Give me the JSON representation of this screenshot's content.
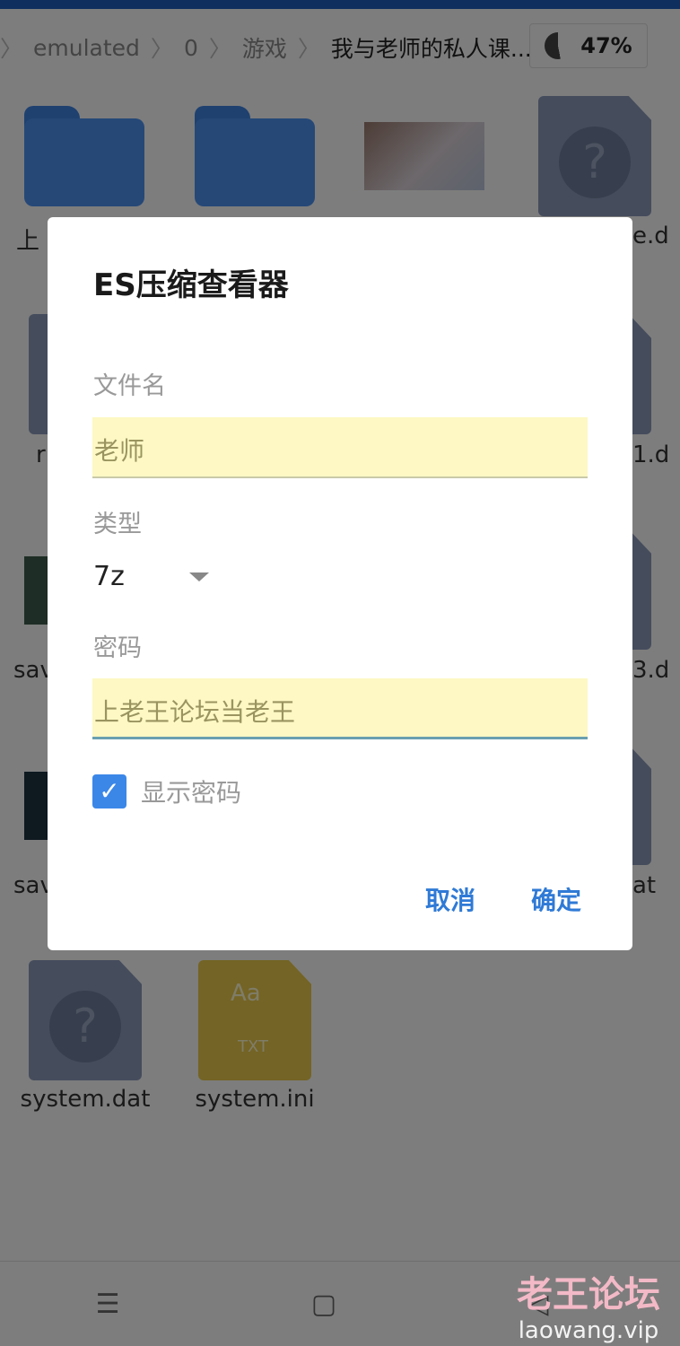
{
  "breadcrumb": {
    "items": [
      "emulated",
      "0",
      "游戏",
      "我与老师的私人课..."
    ],
    "separator": "〉"
  },
  "storage": {
    "percent_label": "47%",
    "used_fraction": 0.47
  },
  "files": {
    "partial_labels": [
      "上",
      "e.d",
      "r",
      "1.d",
      "sav",
      "3.d",
      "sav",
      "at"
    ],
    "bottom": [
      {
        "name": "system.dat",
        "icon": "question-file-icon"
      },
      {
        "name": "system.ini",
        "icon": "txt-file-icon",
        "icon_text": "Aa",
        "icon_sub": "TXT"
      }
    ]
  },
  "dialog": {
    "title": "ES压缩查看器",
    "filename_label": "文件名",
    "filename_value": "老师",
    "type_label": "类型",
    "type_value": "7z",
    "password_label": "密码",
    "password_value": "上老王论坛当老王",
    "show_password_label": "显示密码",
    "show_password_checked": true,
    "cancel": "取消",
    "ok": "确定"
  },
  "nav": {
    "menu": "☰",
    "home": "▢",
    "back": "◁"
  },
  "watermark": {
    "title": "老王论坛",
    "url": "laowang.vip"
  },
  "colors": {
    "accent": "#2f7ad6",
    "checkbox": "#3b87e8",
    "field_bg": "#fdf8c4",
    "folder": "#4a90ee"
  }
}
